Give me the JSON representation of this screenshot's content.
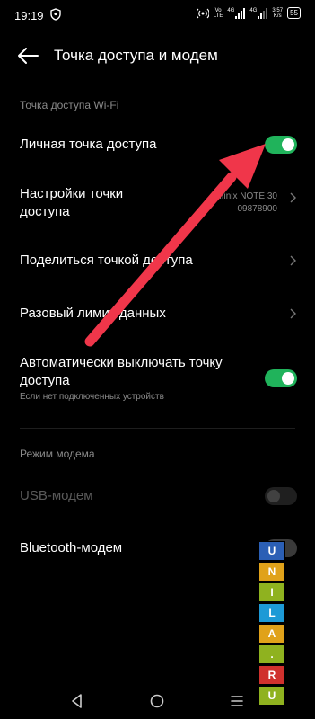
{
  "status_bar": {
    "time": "19:19",
    "vo_top": "Vo",
    "vo_bottom": "LTE",
    "net1": "4G",
    "net2": "4G",
    "speed_top": "3,57",
    "speed_bottom": "K/s",
    "battery": "55"
  },
  "header": {
    "title": "Точка доступа и модем"
  },
  "wifi_section": {
    "label": "Точка доступа Wi-Fi",
    "personal_hotspot": {
      "label": "Личная точка доступа",
      "enabled": true
    },
    "hotspot_settings": {
      "label": "Настройки точки доступа",
      "value_line1": "Infinix NOTE 30",
      "value_line2": "09878900"
    },
    "share_hotspot": {
      "label": "Поделиться точкой доступа"
    },
    "data_limit": {
      "label": "Разовый лимит данных"
    },
    "auto_off": {
      "label": "Автоматически выключать точку доступа",
      "subtitle": "Если нет подключенных устройств",
      "enabled": true
    }
  },
  "modem_section": {
    "label": "Режим модема",
    "usb_modem": {
      "label": "USB-модем",
      "enabled": false
    },
    "bluetooth_modem": {
      "label": "Bluetooth-модем",
      "enabled": false
    }
  },
  "watermark": {
    "letters": [
      "U",
      "N",
      "I",
      "L",
      "A",
      ".",
      "R",
      "U"
    ],
    "colors": [
      "#2b5fb5",
      "#e0a21a",
      "#8fb21f",
      "#1d9ad6",
      "#e0a21a",
      "#8fb21f",
      "#d0312d",
      "#8fb21f"
    ]
  },
  "nav": {
    "icons": [
      "back-triangle-icon",
      "home-circle-icon",
      "recents-menu-icon"
    ]
  },
  "colors": {
    "accent": "#20b35b",
    "annotation_arrow": "#f0364a",
    "background": "#000000"
  }
}
